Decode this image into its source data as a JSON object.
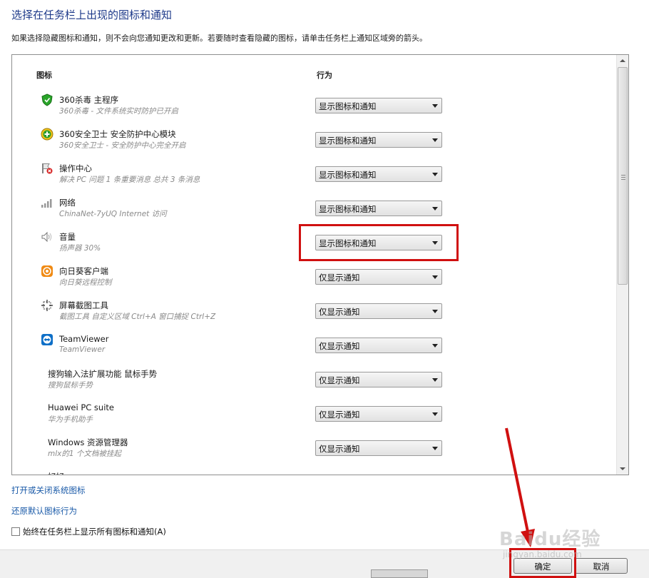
{
  "dialog": {
    "title": "选择在任务栏上出现的图标和通知",
    "description": "如果选择隐藏图标和通知，则不会向您通知更改和更新。若要随时查看隐藏的图标，请单击任务栏上通知区域旁的箭头。"
  },
  "table": {
    "headers": {
      "icon": "图标",
      "behavior": "行为"
    },
    "rows": [
      {
        "name": "360杀毒 主程序",
        "sub": "360杀毒 - 文件系统实时防护已开启",
        "behavior": "显示图标和通知",
        "icon": "shield-green-icon"
      },
      {
        "name": "360安全卫士 安全防护中心模块",
        "sub": "360安全卫士 - 安全防护中心完全开启",
        "behavior": "显示图标和通知",
        "icon": "plus-green-icon"
      },
      {
        "name": "操作中心",
        "sub": "解决 PC 问题 1 条重要消息 总共 3 条消息",
        "behavior": "显示图标和通知",
        "icon": "flag-red-icon"
      },
      {
        "name": "网络",
        "sub": "ChinaNet-7yUQ Internet 访问",
        "behavior": "显示图标和通知",
        "icon": "signal-bars-icon"
      },
      {
        "name": "音量",
        "sub": "扬声器 30%",
        "behavior": "显示图标和通知",
        "icon": "speaker-icon"
      },
      {
        "name": "向日葵客户端",
        "sub": "向日葵远程控制",
        "behavior": "仅显示通知",
        "icon": "sunflower-icon"
      },
      {
        "name": "屏幕截图工具",
        "sub": "截图工具 自定义区域 Ctrl+A 窗口捕捉 Ctrl+Z",
        "behavior": "仅显示通知",
        "icon": "crosshair-icon"
      },
      {
        "name": "TeamViewer",
        "sub": "TeamViewer",
        "behavior": "仅显示通知",
        "icon": "teamviewer-icon"
      },
      {
        "name": "搜狗输入法扩展功能 鼠标手势",
        "sub": "搜狗鼠标手势",
        "behavior": "仅显示通知",
        "icon": ""
      },
      {
        "name": "Huawei PC suite",
        "sub": "华为手机助手",
        "behavior": "仅显示通知",
        "icon": ""
      },
      {
        "name": "Windows 资源管理器",
        "sub": "mlx的1 个文档被挂起",
        "behavior": "仅显示通知",
        "icon": ""
      },
      {
        "name": "好好",
        "sub": "",
        "behavior": "",
        "icon": ""
      }
    ]
  },
  "links": {
    "toggle_system_icons": "打开或关闭系统图标",
    "restore_defaults": "还原默认图标行为"
  },
  "checkbox": {
    "label": "始终在任务栏上显示所有图标和通知(A)",
    "checked": false
  },
  "buttons": {
    "ok": "确定",
    "cancel": "取消"
  },
  "watermark": {
    "brand": "Baidu经验",
    "url": "jingyan.baidu.com"
  },
  "colors": {
    "title": "#1e3a8a",
    "link": "#1a5aa8",
    "highlight": "#d01010"
  }
}
